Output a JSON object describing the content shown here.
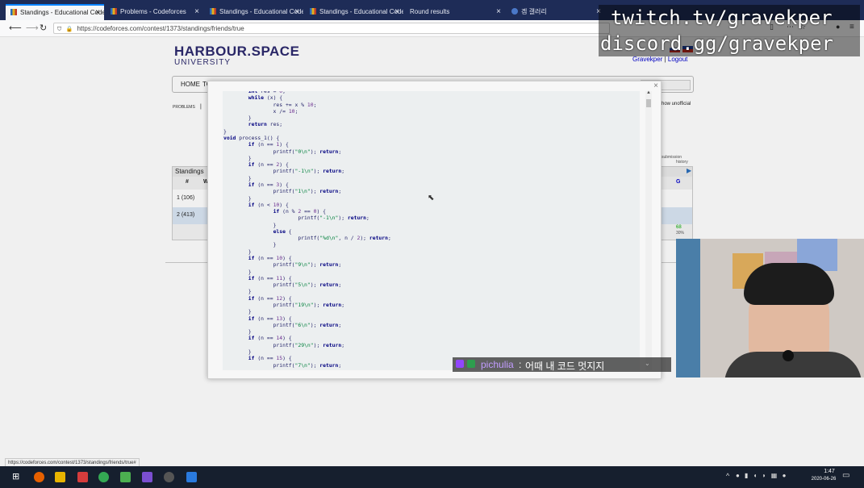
{
  "browser": {
    "tabs": [
      {
        "title": "Standings - Educational Code",
        "active": true,
        "icon": "chart-icon"
      },
      {
        "title": "Problems - Codeforces",
        "active": false,
        "icon": "chart-icon"
      },
      {
        "title": "Standings - Educational Code",
        "active": false,
        "icon": "chart-icon"
      },
      {
        "title": "Standings - Educational Code",
        "active": false,
        "icon": "chart-icon"
      },
      {
        "title": "Round results",
        "active": false,
        "icon": "page-icon"
      },
      {
        "title": "겜 갤러리",
        "active": false,
        "icon": "gallery-icon"
      }
    ],
    "url": "https://codeforces.com/contest/1373/standings/friends/true",
    "status_url": "https://codeforces.com/contest/1373/standings/friends/true#"
  },
  "site": {
    "logo_main": "HARBOUR.SPACE",
    "logo_sub": "UNIVERSITY",
    "user": "Gravekper",
    "separator": "|",
    "logout": "Logout",
    "menu_home": "HOME",
    "menu_to": "TO",
    "problems": "PROBLEMS",
    "show_unofficial": "how unofficial",
    "submission_history_1": "submission",
    "submission_history_2": "history"
  },
  "standings": {
    "title": "Standings",
    "col_rank": "#",
    "col_who": "W",
    "col_g": "G",
    "rows": [
      {
        "rank": "1 (106)"
      },
      {
        "rank": "2 (413)"
      }
    ],
    "footer_accepted": "68",
    "footer_pct": "30%"
  },
  "modal": {
    "close": "×",
    "code_lines": [
      "        int res = 0;",
      "        while (x) {",
      "                res += x % 10;",
      "                x /= 10;",
      "        }",
      "        return res;",
      "}",
      "void process_1() {",
      "        if (n == 1) {",
      "                printf(\"0\\n\"); return;",
      "        }",
      "        if (n == 2) {",
      "                printf(\"-1\\n\"); return;",
      "        }",
      "        if (n == 3) {",
      "                printf(\"1\\n\"); return;",
      "        }",
      "        if (n < 10) {",
      "                if (n % 2 == 0) {",
      "                        printf(\"-1\\n\"); return;",
      "                }",
      "                else {",
      "                        printf(\"%d\\n\", n / 2); return;",
      "                }",
      "        }",
      "        if (n == 10) {",
      "                printf(\"9\\n\"); return;",
      "        }",
      "        if (n == 11) {",
      "                printf(\"5\\n\"); return;",
      "        }",
      "        if (n == 12) {",
      "                printf(\"19\\n\"); return;",
      "        }",
      "        if (n == 13) {",
      "                printf(\"6\\n\"); return;",
      "        }",
      "        if (n == 14) {",
      "                printf(\"29\\n\"); return;",
      "        }",
      "        if (n == 15) {",
      "                printf(\"7\\n\"); return;"
    ]
  },
  "chat": {
    "username": "pichulia",
    "separator": ":",
    "message": "어때 내 코드 멋지지"
  },
  "overlay": {
    "line1": "twitch.tv/gravekper",
    "line2": "discord.gg/gravekper"
  },
  "taskbar": {
    "time": "1:47",
    "date": "2020-06-26"
  },
  "colors": {
    "tabbar": "#1e2c57",
    "logo": "#2d2a6e",
    "link": "#0000cc",
    "taskbar": "#161f2e"
  }
}
